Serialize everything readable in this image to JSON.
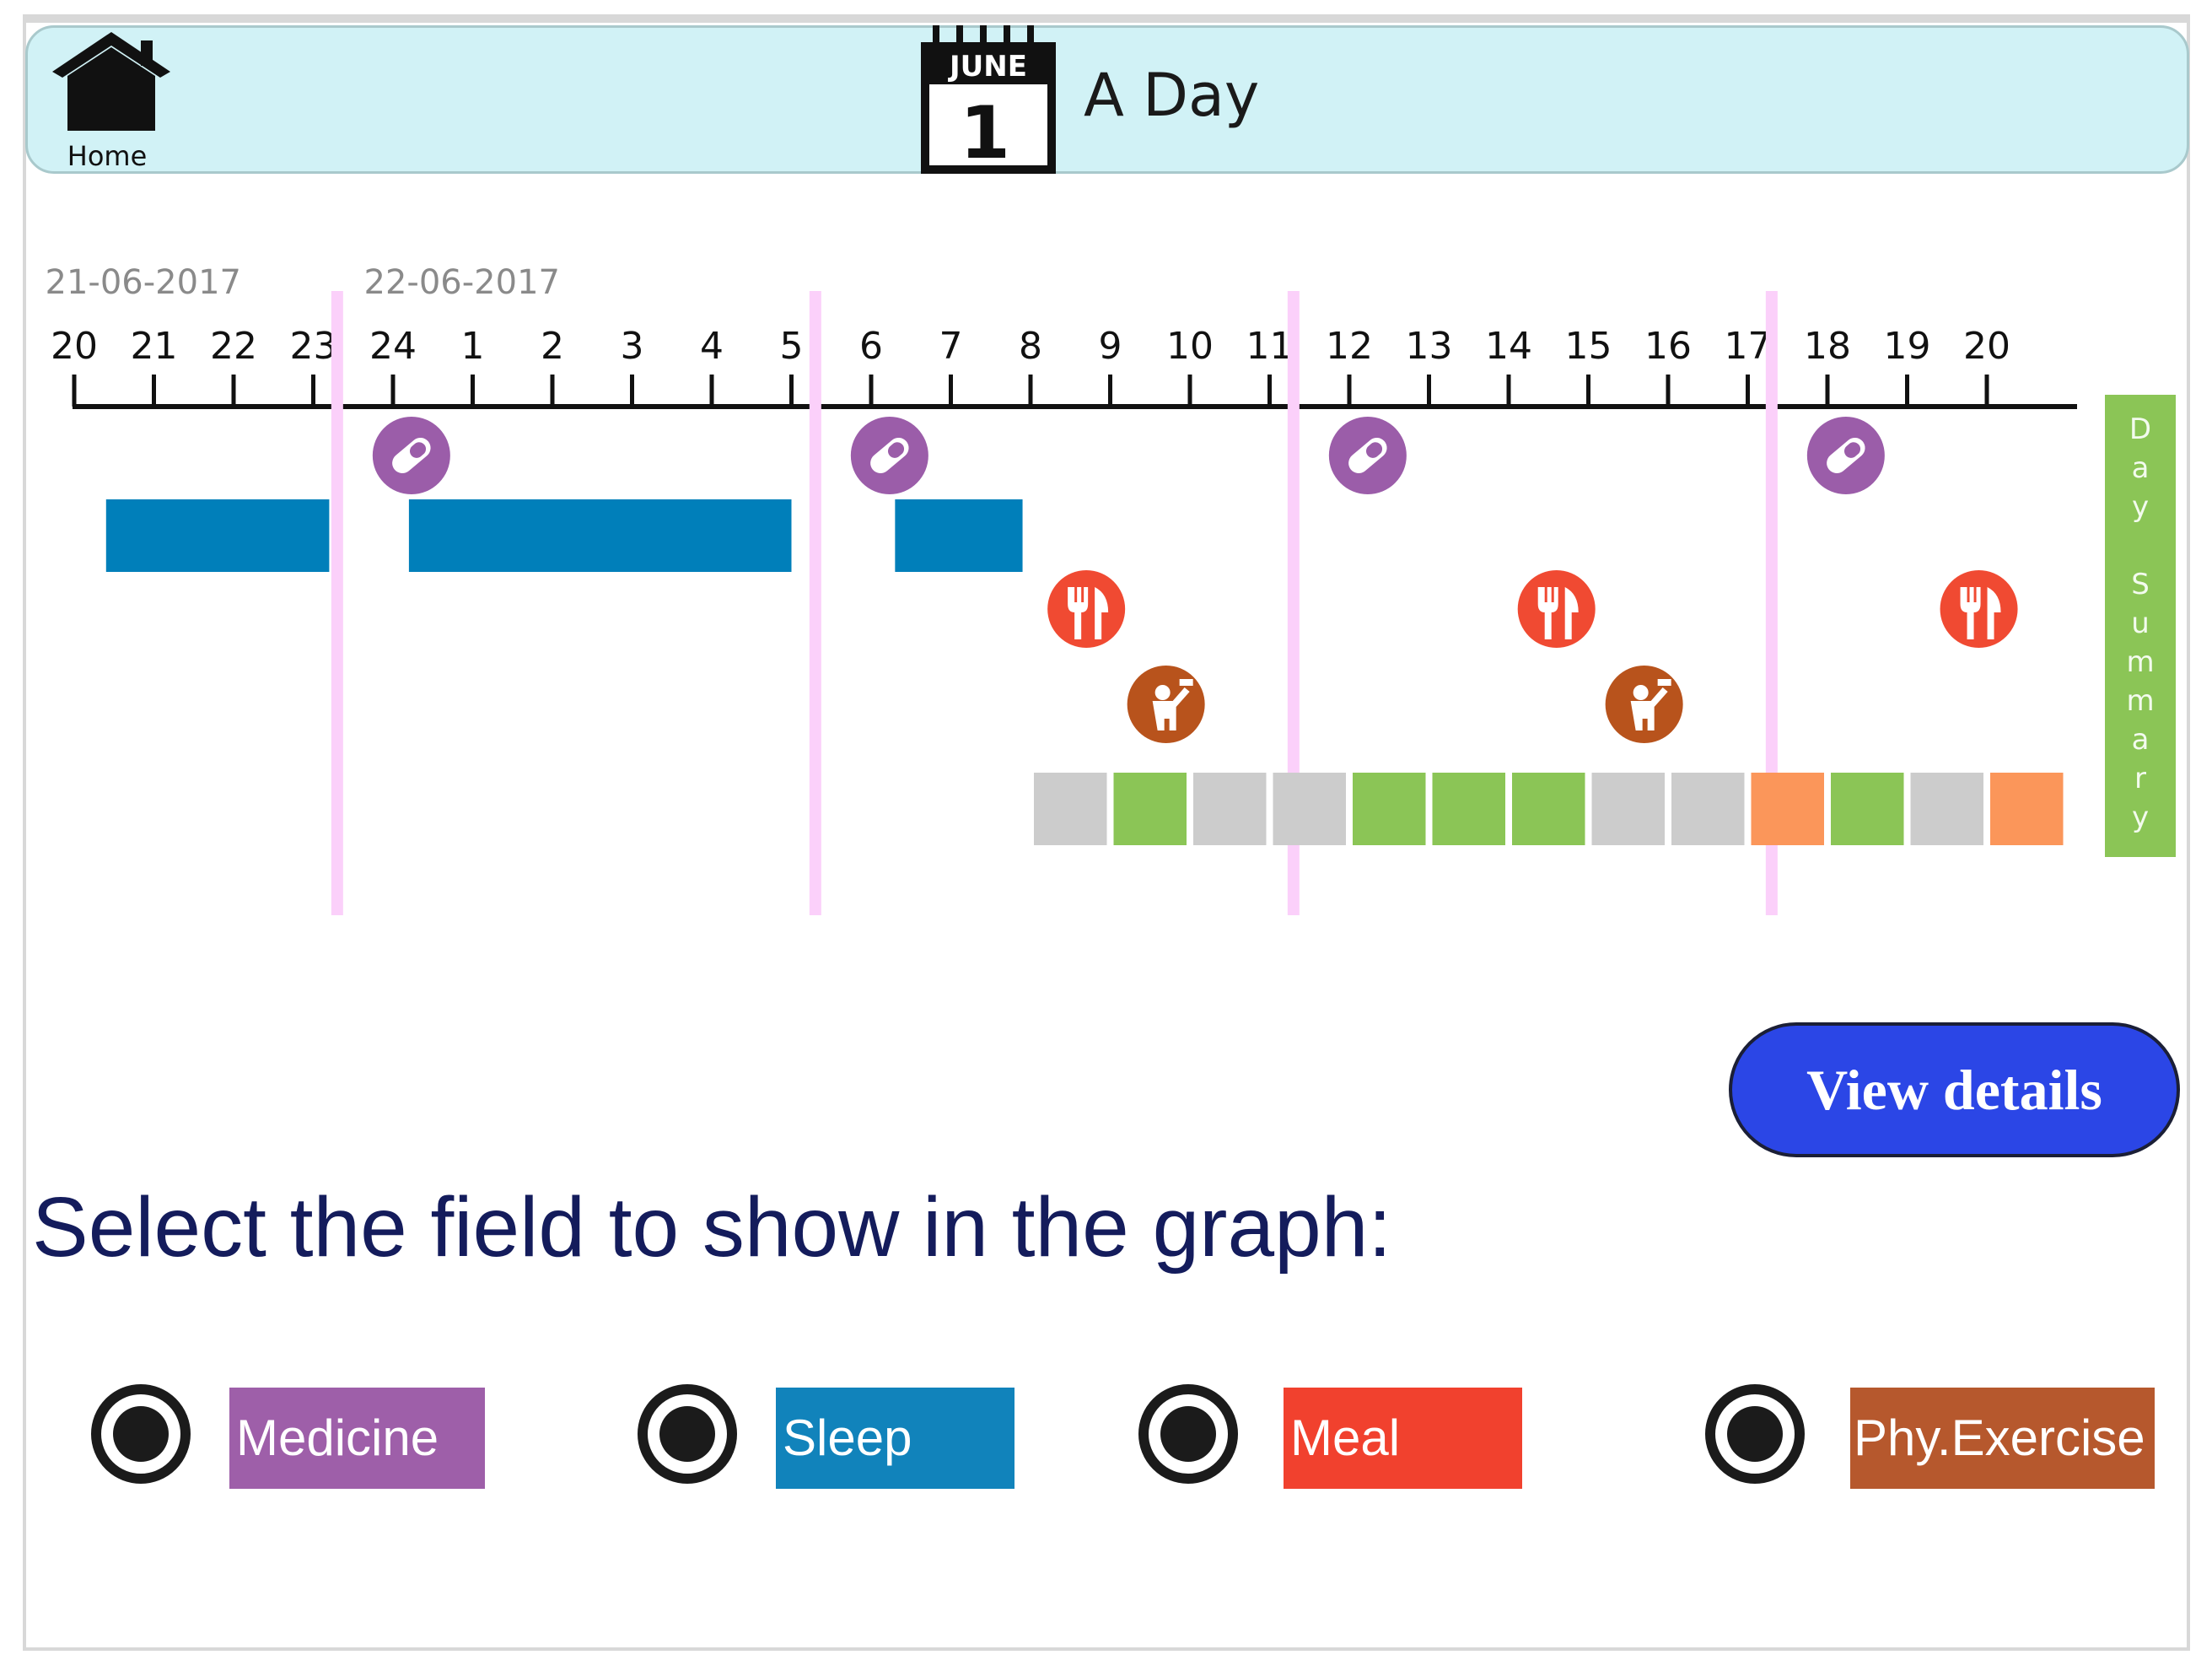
{
  "header": {
    "home_label": "Home",
    "calendar_month": "JUNE",
    "calendar_day": "1",
    "title": "A Day"
  },
  "timeline": {
    "dates": [
      "21-06-2017",
      "22-06-2017"
    ],
    "hour_ticks": [
      "20",
      "21",
      "22",
      "23",
      "24",
      "1",
      "2",
      "3",
      "4",
      "5",
      "6",
      "7",
      "8",
      "9",
      "10",
      "11",
      "12",
      "13",
      "14",
      "15",
      "16",
      "17",
      "18",
      "19",
      "20"
    ],
    "day_boundary_hour_index": 3.3,
    "medicine_times": [
      23.3,
      5.3,
      11.3,
      17.3
    ],
    "sleep_periods": [
      [
        20.4,
        23.2
      ],
      [
        24.2,
        5.0
      ],
      [
        6.3,
        7.9
      ]
    ],
    "meal_times": [
      8.7,
      14.6,
      19.9
    ],
    "exercise_times": [
      9.7,
      15.7
    ],
    "hourly_status": [
      "gray",
      "green",
      "gray",
      "gray",
      "green",
      "green",
      "green",
      "gray",
      "gray",
      "orange",
      "green",
      "gray",
      "orange"
    ],
    "status_start_hour": 8,
    "colors": {
      "medicine": "#9b5da9",
      "sleep": "#007fba",
      "meal": "#f04a32",
      "exercise": "#b8531c",
      "marker_line": "#fbd0fa",
      "gray": "#cccccc",
      "green": "#8bc556",
      "orange": "#fb965a"
    }
  },
  "day_summary_label": "Day Summary",
  "view_details_label": "View details",
  "select_prompt": "Select the field to show in the graph:",
  "fields": [
    {
      "label": "Medicine",
      "color": "#9e5fa9"
    },
    {
      "label": "Sleep",
      "color": "#1183bb"
    },
    {
      "label": "Meal",
      "color": "#f1412e"
    },
    {
      "label": "Phy.Exercise",
      "color": "#b6582d"
    }
  ]
}
